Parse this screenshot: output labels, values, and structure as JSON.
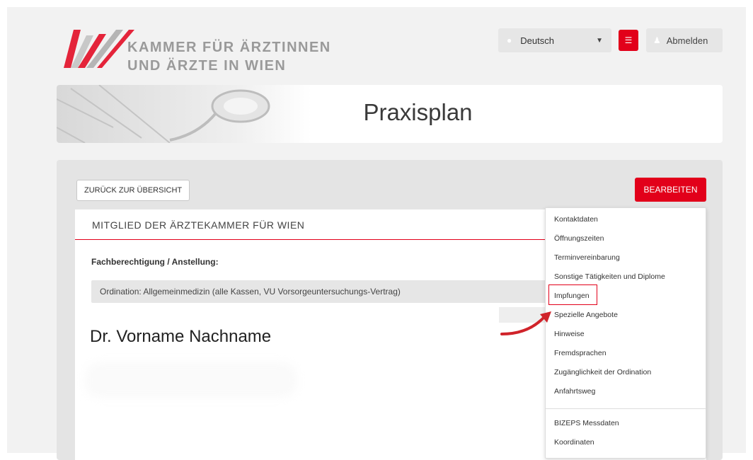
{
  "header": {
    "org_line1": "KAMMER FÜR ÄRZTINNEN",
    "org_line2": "UND ÄRZTE IN WIEN",
    "language": "Deutsch",
    "logout": "Abmelden",
    "colors": {
      "accent": "#e2001a",
      "logo_grey": "#9a9a9a"
    }
  },
  "banner": {
    "title": "Praxisplan"
  },
  "toolbar": {
    "back_label": "ZURÜCK ZUR ÜBERSICHT",
    "edit_label": "BEARBEITEN"
  },
  "card": {
    "header": "MITGLIED DER ÄRZTEKAMMER FÜR WIEN",
    "fach_label": "Fachberechtigung / Anstellung:",
    "fach_value": "Ordination: Allgemeinmedizin (alle Kassen, VU Vorsorgeuntersuchungs-Vertrag)",
    "doctor_name": "Dr. Vorname Nachname"
  },
  "dropdown": {
    "items": [
      "Kontaktdaten",
      "Öffnungszeiten",
      "Terminvereinbarung",
      "Sonstige Tätigkeiten und Diplome",
      "Impfungen",
      "Spezielle Angebote",
      "Hinweise",
      "Fremdsprachen",
      "Zugänglichkeit der Ordination",
      "Anfahrtsweg",
      "BIZEPS Messdaten",
      "Koordinaten"
    ],
    "highlighted": "Impfungen"
  }
}
